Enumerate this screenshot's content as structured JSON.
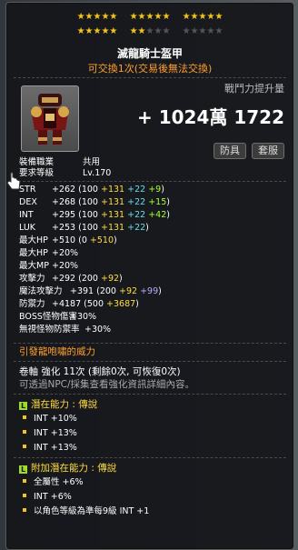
{
  "stars": {
    "row1": {
      "g1": "★★★★★",
      "g2": "★★★★★",
      "g3": "★★★★★"
    },
    "row2": {
      "g1": "★★★★★",
      "g2_on": "★★",
      "g2_off": "★★★",
      "g3": "★★★★★"
    }
  },
  "item": {
    "name": "滅龍騎士盔甲",
    "trade_status": "可交換1次(交易後無法交換)"
  },
  "power": {
    "label": "戰鬥力提升量",
    "value": "+ 1024萬 1722",
    "btn1": "防具",
    "btn2": "套服"
  },
  "req": {
    "job_label": "裝備職業",
    "job_value": "共用",
    "level_label": "要求等級",
    "level_value": "Lv.170"
  },
  "stats": [
    {
      "label": "STR",
      "parts": [
        [
          "+262 (100 ",
          "w"
        ],
        [
          "+131 ",
          "y"
        ],
        [
          "+22 ",
          "c"
        ],
        [
          "+9",
          "g"
        ],
        [
          ")",
          "w"
        ]
      ]
    },
    {
      "label": "DEX",
      "parts": [
        [
          "+268 (100 ",
          "w"
        ],
        [
          "+131 ",
          "y"
        ],
        [
          "+22 ",
          "c"
        ],
        [
          "+15",
          "g"
        ],
        [
          ")",
          "w"
        ]
      ]
    },
    {
      "label": "INT",
      "parts": [
        [
          "+295 (100 ",
          "w"
        ],
        [
          "+131 ",
          "y"
        ],
        [
          "+22 ",
          "c"
        ],
        [
          "+42",
          "g"
        ],
        [
          ")",
          "w"
        ]
      ]
    },
    {
      "label": "LUK",
      "parts": [
        [
          "+253 (100 ",
          "w"
        ],
        [
          "+131 ",
          "y"
        ],
        [
          "+22",
          "c"
        ],
        [
          ")",
          "w"
        ]
      ]
    },
    {
      "label": "最大HP",
      "parts": [
        [
          "+510 (0 ",
          "w"
        ],
        [
          "+510",
          "y"
        ],
        [
          ")",
          "w"
        ]
      ]
    },
    {
      "label": "最大HP",
      "parts": [
        [
          "+20%",
          "w"
        ]
      ]
    },
    {
      "label": "最大MP",
      "parts": [
        [
          "+20%",
          "w"
        ]
      ]
    },
    {
      "label": "攻擊力",
      "parts": [
        [
          "+292 (200 ",
          "w"
        ],
        [
          "+92",
          "y"
        ],
        [
          ")",
          "w"
        ]
      ]
    },
    {
      "label": "魔法攻擊力",
      "parts": [
        [
          "+391 (200 ",
          "w"
        ],
        [
          "+92 ",
          "y"
        ],
        [
          "+99",
          "p"
        ],
        [
          ")",
          "w"
        ]
      ]
    },
    {
      "label": "防禦力",
      "parts": [
        [
          "+4187 (500 ",
          "w"
        ],
        [
          "+3687",
          "y"
        ],
        [
          ")",
          "w"
        ]
      ]
    },
    {
      "label": "BOSS怪物傷害",
      "parts": [
        [
          "+30%",
          "w"
        ]
      ]
    },
    {
      "label": "無視怪物防禦率",
      "parts": [
        [
          "+30%",
          "w"
        ]
      ]
    }
  ],
  "set_effect": "引發龍咆嘯的威力",
  "scroll": {
    "line1": "卷軸 強化 11次 (剩餘0次, 可恢復0次)",
    "line2": "可透過NPC/採集查看強化資訊詳細內容。"
  },
  "potential": {
    "badge": "L",
    "title": "潛在能力 : 傳說",
    "lines": [
      "INT +10%",
      "INT +13%",
      "INT +13%"
    ]
  },
  "additional": {
    "badge": "L",
    "title": "附加潛在能力 : 傳說",
    "lines": [
      "全屬性 +6%",
      "INT +6%",
      "以角色等級為準每9級 INT +1"
    ]
  },
  "colors": {
    "star": "#f3c51b",
    "orange": "#ff9f2d",
    "yellow": "#ffdd44",
    "green": "#aaff33",
    "cyan": "#66ddee",
    "purple": "#bbaaff"
  }
}
